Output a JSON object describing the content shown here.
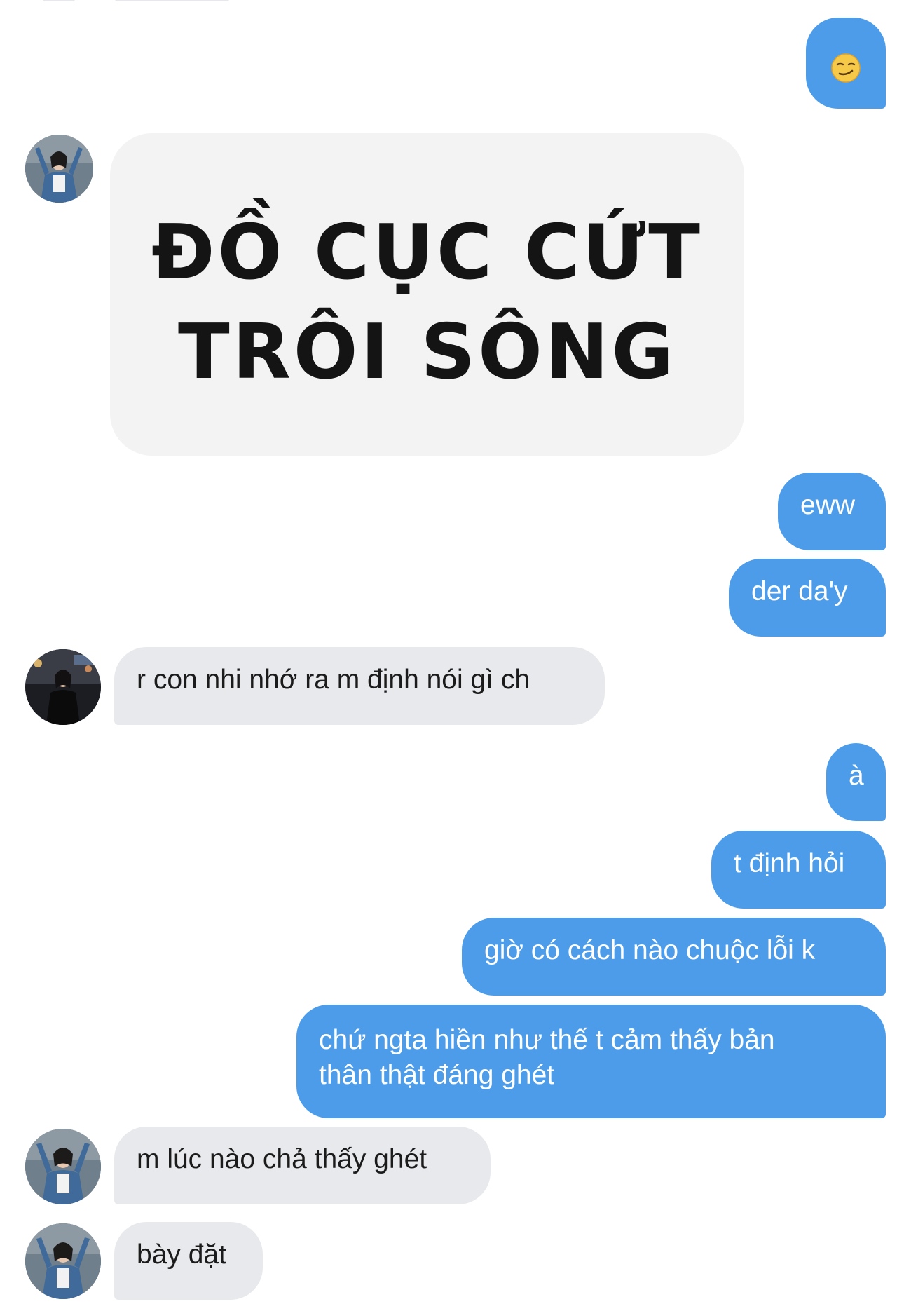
{
  "thread": {
    "messages": [
      {
        "side": "out",
        "kind": "emoji",
        "icon": "smirking-face-emoji"
      },
      {
        "side": "in",
        "kind": "sticker",
        "lines": [
          "ĐỒ CỤC CỨT",
          "TRÔI SÔNG"
        ]
      },
      {
        "side": "out",
        "text": "eww"
      },
      {
        "side": "out",
        "text": "der da'y"
      },
      {
        "side": "in",
        "text": "r con nhi nhớ ra m định nói gì ch"
      },
      {
        "side": "out",
        "text": "à"
      },
      {
        "side": "out",
        "text": "t định hỏi"
      },
      {
        "side": "out",
        "text": "giờ có cách nào chuộc lỗi k"
      },
      {
        "side": "out",
        "text": "chứ ngta hiền như thế t cảm thấy bản\nthân thật đáng ghét"
      },
      {
        "side": "in",
        "text": "m lúc nào chả thấy ghét"
      },
      {
        "side": "in",
        "text": "bày đặt"
      }
    ]
  },
  "colors": {
    "outgoing_bubble": "#4c9cea",
    "incoming_bubble": "#e8e9ec",
    "sticker_bg": "#f3f3f4"
  }
}
